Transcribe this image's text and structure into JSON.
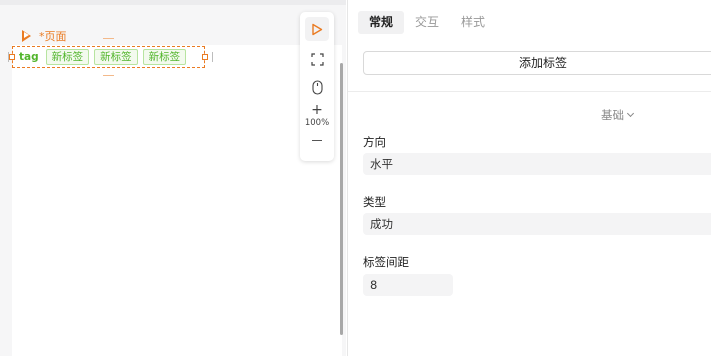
{
  "canvas": {
    "page_label": "*页面",
    "tags": [
      "tag",
      "新标签",
      "新标签",
      "新标签"
    ]
  },
  "toolbar": {
    "zoom": "100%",
    "plus": "+",
    "icons": [
      "play-icon",
      "fit-screen-icon",
      "mouse-icon"
    ]
  },
  "panel": {
    "tabs": [
      {
        "label": "常规",
        "active": true
      },
      {
        "label": "交互",
        "active": false
      },
      {
        "label": "样式",
        "active": false
      }
    ],
    "add_tag_label": "添加标签",
    "section_title": "基础",
    "fields": {
      "direction": {
        "label": "方向",
        "value": "水平"
      },
      "type": {
        "label": "类型",
        "value": "成功"
      },
      "spacing": {
        "label": "标签间距",
        "value": "8"
      }
    }
  },
  "colors": {
    "accent": "#ea7b22",
    "tag_green": "#52b52c",
    "tag_border": "#b7e4a0"
  }
}
